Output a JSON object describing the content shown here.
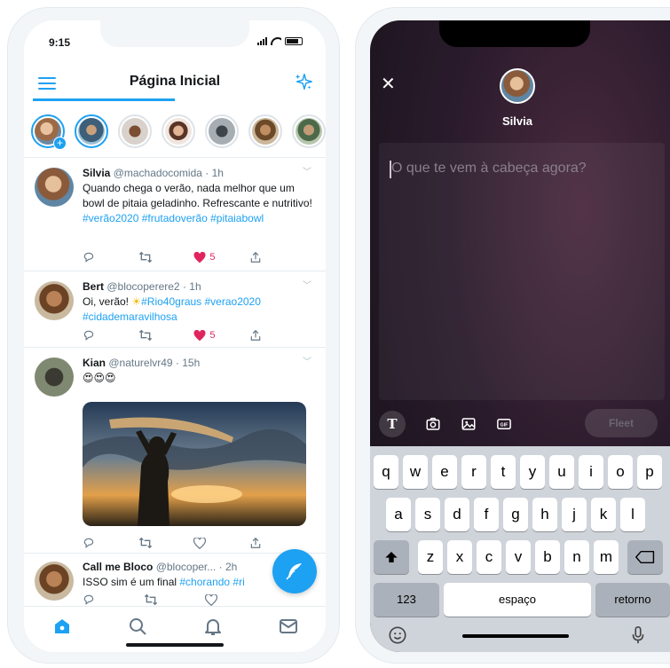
{
  "feed_phone": {
    "status_time": "9:15",
    "header": {
      "title": "Página Inicial"
    },
    "fleets": [
      {
        "name": "own-fleet",
        "seen": false,
        "add": "+"
      },
      {
        "name": "fleet-2",
        "seen": false
      },
      {
        "name": "fleet-3",
        "seen": true
      },
      {
        "name": "fleet-4",
        "seen": true
      },
      {
        "name": "fleet-5",
        "seen": true
      },
      {
        "name": "fleet-6",
        "seen": true
      },
      {
        "name": "fleet-7",
        "seen": true
      }
    ],
    "tweets": [
      {
        "name": "Silvia",
        "handle": "@machadocomida",
        "time": "· 1h",
        "text": "Quando chega o verão, nada melhor que um bowl de pitaia geladinho. Refrescante e nutritivo!",
        "tags": "#verão2020 #frutadoverão #pitaiabowl",
        "likes": "5"
      },
      {
        "name": "Bert",
        "handle": "@blocoperere2",
        "time": "· 1h",
        "text_prefix": "Oi, verão! ",
        "emoji": "☀",
        "tags": "#Rio40graus #verao2020 #cidademaravilhosa",
        "likes": "5"
      },
      {
        "name": "Kian",
        "handle": "@naturelvr49",
        "time": "· 15h",
        "emoji_text": "😍😍😍"
      },
      {
        "name": "Call me Bloco",
        "handle": "@blocoper...",
        "time": "· 2h",
        "text": "ISSO sim é um final",
        "tags": "#chorando #ri"
      }
    ],
    "colors": {
      "accent": "#1da1f2",
      "like": "#e0245e"
    }
  },
  "fleet_phone": {
    "close": "✕",
    "user_name": "Silvia",
    "placeholder": "O que te vem à cabeça agora?",
    "tool_text": "T",
    "tool_gif": "GIF",
    "fleet_button": "Fleet",
    "keyboard": {
      "row1": [
        "q",
        "w",
        "e",
        "r",
        "t",
        "y",
        "u",
        "i",
        "o",
        "p"
      ],
      "row2": [
        "a",
        "s",
        "d",
        "f",
        "g",
        "h",
        "j",
        "k",
        "l"
      ],
      "row3": [
        "z",
        "x",
        "c",
        "v",
        "b",
        "n",
        "m"
      ],
      "numbers": "123",
      "space": "espaço",
      "return": "retorno"
    }
  }
}
